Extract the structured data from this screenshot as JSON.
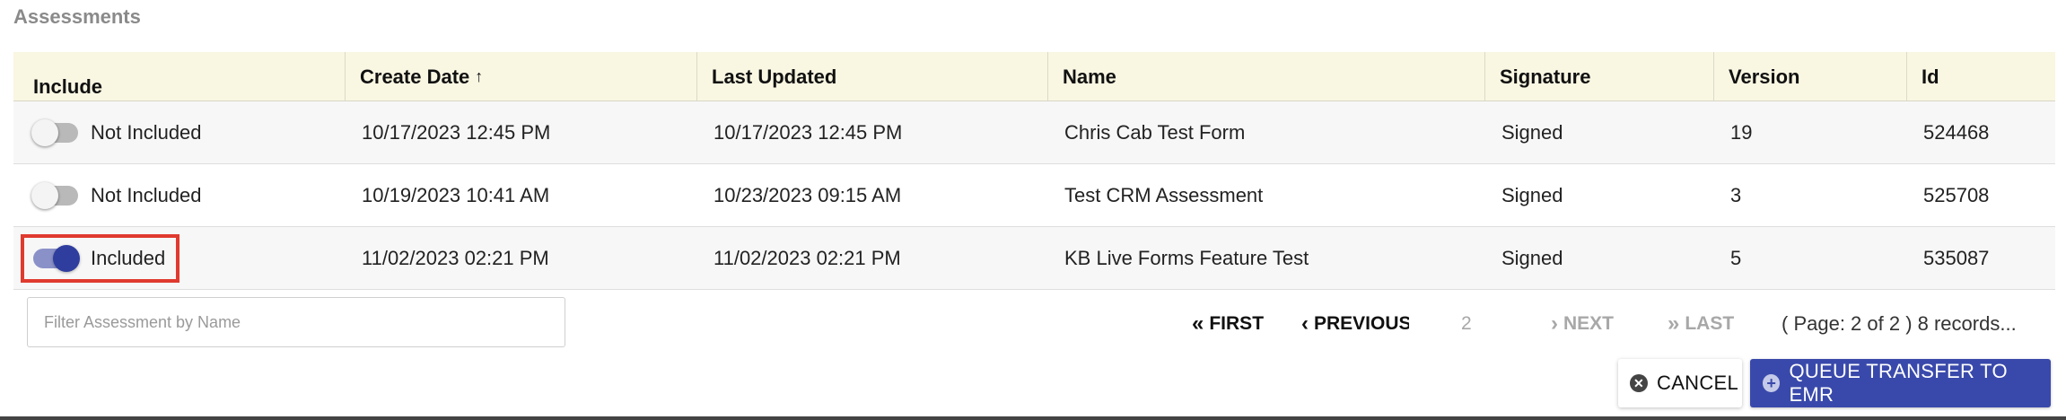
{
  "section": {
    "title": "Assessments"
  },
  "table": {
    "headers": {
      "include": "Include",
      "create_date": "Create Date",
      "sort_indicator": "↑",
      "last_updated": "Last Updated",
      "name": "Name",
      "signature": "Signature",
      "version": "Version",
      "id": "Id"
    },
    "rows": [
      {
        "included": false,
        "include_label": "Not Included",
        "create_date": "10/17/2023 12:45 PM",
        "last_updated": "10/17/2023 12:45 PM",
        "name": "Chris Cab Test Form",
        "signature": "Signed",
        "version": "19",
        "id": "524468"
      },
      {
        "included": false,
        "include_label": "Not Included",
        "create_date": "10/19/2023 10:41 AM",
        "last_updated": "10/23/2023 09:15 AM",
        "name": "Test CRM Assessment",
        "signature": "Signed",
        "version": "3",
        "id": "525708"
      },
      {
        "included": true,
        "include_label": "Included",
        "create_date": "11/02/2023 02:21 PM",
        "last_updated": "11/02/2023 02:21 PM",
        "name": "KB Live Forms Feature Test",
        "signature": "Signed",
        "version": "5",
        "id": "535087"
      }
    ]
  },
  "filter": {
    "placeholder": "Filter Assessment by Name",
    "value": ""
  },
  "pagination": {
    "first": "FIRST",
    "previous": "PREVIOUS",
    "page_number": "2",
    "next": "NEXT",
    "last": "LAST",
    "info": "( Page: 2 of 2 ) 8 records..."
  },
  "actions": {
    "cancel": "CANCEL",
    "queue": "QUEUE TRANSFER TO EMR"
  },
  "colors": {
    "header_bg": "#f9f6e2",
    "primary": "#3949ab",
    "highlight": "#e03a2f"
  }
}
